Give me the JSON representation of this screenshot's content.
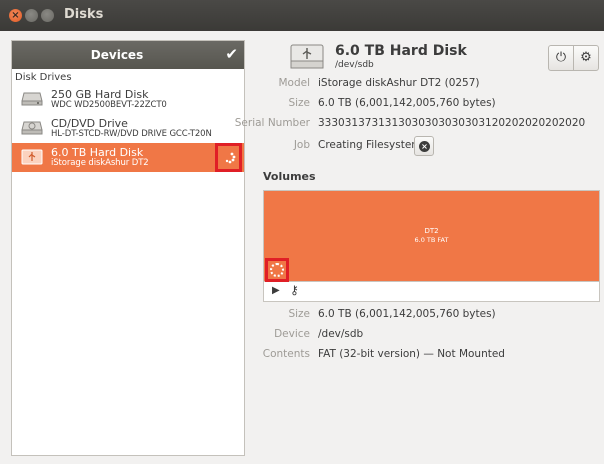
{
  "window": {
    "title": "Disks"
  },
  "sidebar": {
    "header": "Devices",
    "section": "Disk Drives",
    "drives": [
      {
        "name": "250 GB Hard Disk",
        "model": "WDC WD2500BEVT-22ZCT0"
      },
      {
        "name": "CD/DVD Drive",
        "model": "HL-DT-STCD-RW/DVD DRIVE GCC-T20N"
      },
      {
        "name": "6.0 TB Hard Disk",
        "model": "iStorage diskAshur DT2"
      }
    ]
  },
  "disk": {
    "title": "6.0 TB Hard Disk",
    "device": "/dev/sdb",
    "model_label": "Model",
    "model": "iStorage diskAshur DT2 (0257)",
    "size_label": "Size",
    "size": "6.0 TB (6,001,142,005,760 bytes)",
    "serial_label": "Serial Number",
    "serial": "3330313731313030303030303120202020202020",
    "job_label": "Job",
    "job": "Creating Filesystem"
  },
  "volumes": {
    "heading": "Volumes",
    "partition_name": "DT2",
    "partition_desc": "6.0 TB FAT",
    "size_label": "Size",
    "size": "6.0 TB (6,001,142,005,760 bytes)",
    "device_label": "Device",
    "device": "/dev/sdb",
    "contents_label": "Contents",
    "contents": "FAT (32-bit version) — Not Mounted"
  },
  "colors": {
    "accent": "#f07746",
    "highlight": "#e01f26",
    "titlebar": "#3c3b37"
  }
}
